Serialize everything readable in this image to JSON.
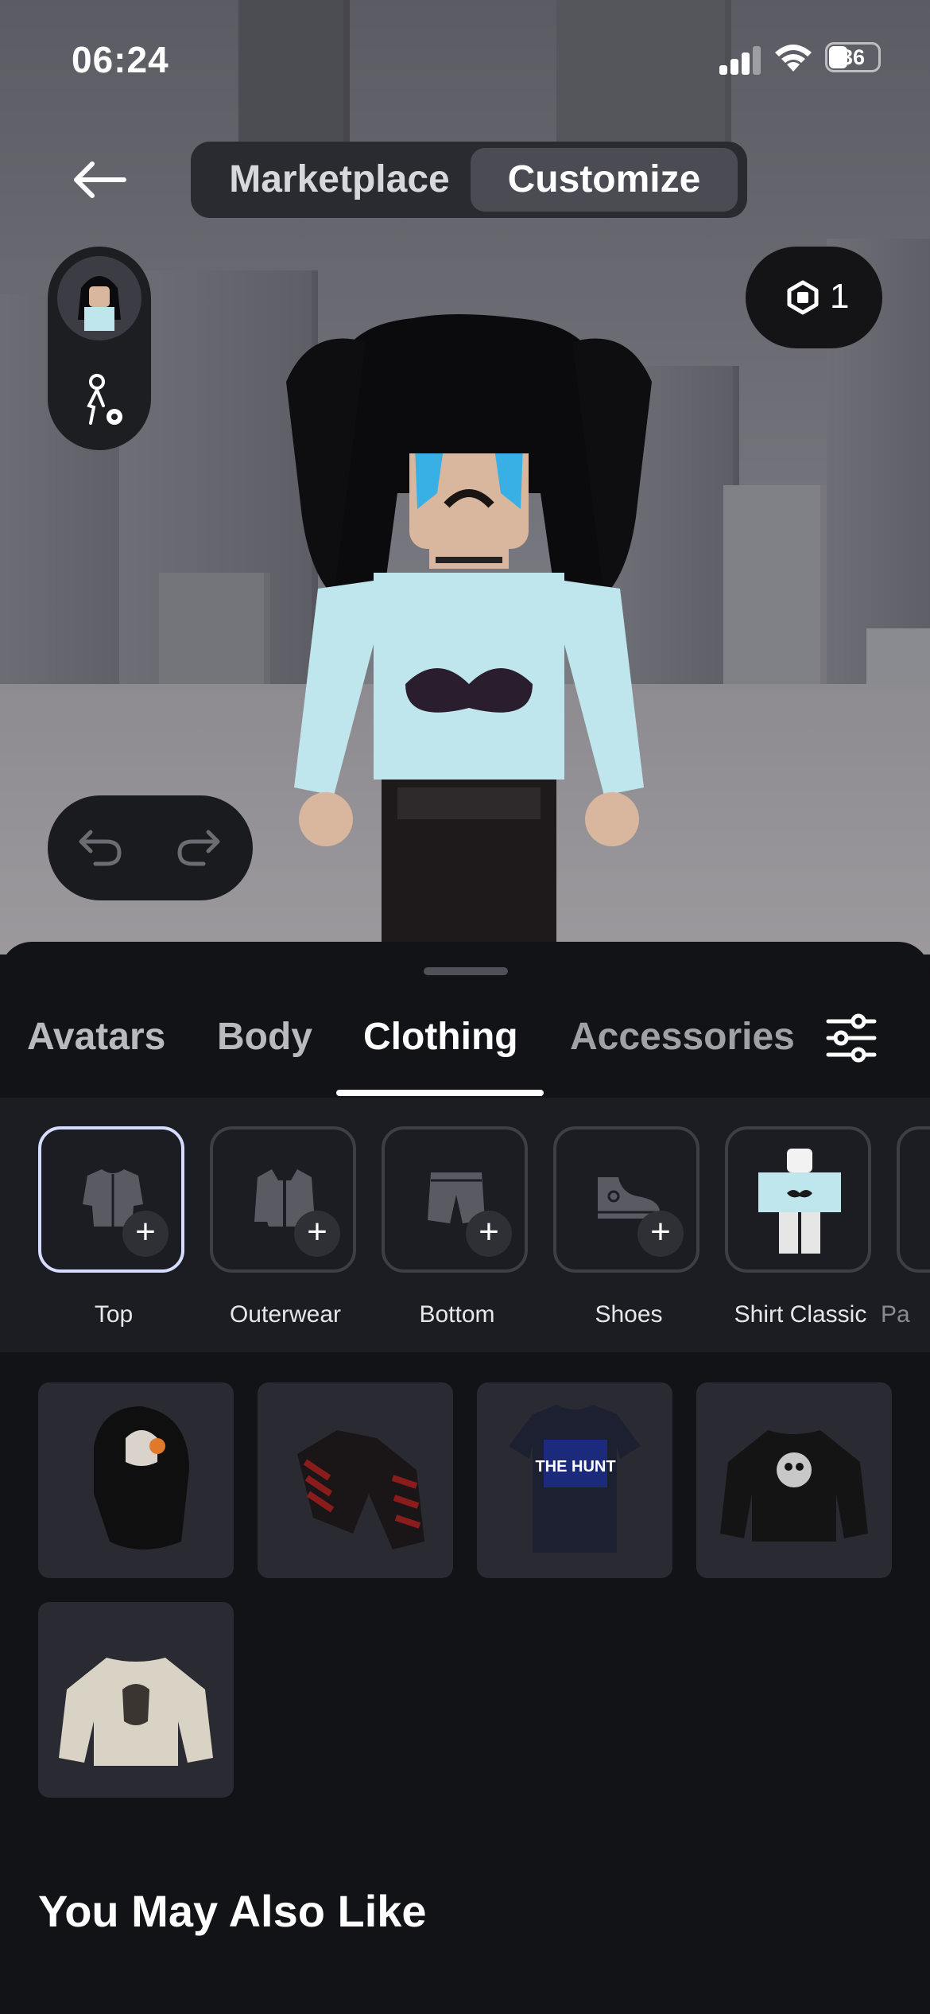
{
  "status_bar": {
    "time": "06:24",
    "battery": "36"
  },
  "header": {
    "segments": [
      {
        "label": "Marketplace",
        "active": false
      },
      {
        "label": "Customize",
        "active": true
      }
    ],
    "robux_count": "1"
  },
  "tabs": [
    {
      "label": "Avatars",
      "active": false
    },
    {
      "label": "Body",
      "active": false
    },
    {
      "label": "Clothing",
      "active": true
    },
    {
      "label": "Accessories",
      "active": false
    }
  ],
  "categories": [
    {
      "label": "Top",
      "icon": "shirt-icon",
      "selected": true
    },
    {
      "label": "Outerwear",
      "icon": "jacket-icon",
      "selected": false
    },
    {
      "label": "Bottom",
      "icon": "shorts-icon",
      "selected": false
    },
    {
      "label": "Shoes",
      "icon": "sneaker-icon",
      "selected": false
    },
    {
      "label": "Shirt Classic",
      "icon": "classic-shirt-thumbnail",
      "selected": false
    },
    {
      "label": "Pa",
      "icon": "",
      "selected": false
    }
  ],
  "items": [
    {
      "name": "black-hoodie-cat"
    },
    {
      "name": "red-black-striped-jacket"
    },
    {
      "name": "the-hunt-tshirt"
    },
    {
      "name": "black-sweatshirt-graphic"
    },
    {
      "name": "cream-sweatshirt"
    }
  ],
  "item_text": {
    "hunt_shirt": "THE HUNT"
  },
  "section": {
    "title": "You May Also Like"
  },
  "colors": {
    "accent_selected": "#d6dcff",
    "sheet_bg": "#121317",
    "tile_bg": "#2a2b32"
  }
}
